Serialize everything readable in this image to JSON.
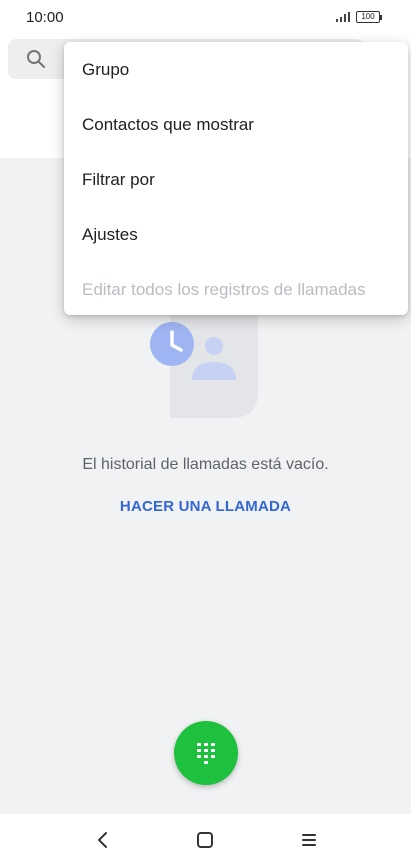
{
  "status_bar": {
    "time": "10:00",
    "battery": "100"
  },
  "search": {
    "icon": "search-icon"
  },
  "menu": {
    "items": [
      {
        "label": "Grupo",
        "enabled": true
      },
      {
        "label": "Contactos que mostrar",
        "enabled": true
      },
      {
        "label": "Filtrar por",
        "enabled": true
      },
      {
        "label": "Ajustes",
        "enabled": true
      },
      {
        "label": "Editar todos los registros de llamadas",
        "enabled": false
      }
    ]
  },
  "main": {
    "empty_message": "El historial de llamadas está vacío.",
    "make_call_label": "HACER UNA LLAMADA",
    "illustration_icon": "call-history-empty-icon"
  },
  "fab": {
    "icon": "dialpad-icon",
    "color": "#1ec13d"
  },
  "nav": {
    "back_icon": "back-icon",
    "home_icon": "home-icon",
    "menu_icon": "menu-icon"
  },
  "colors": {
    "accent": "#3367d6",
    "background": "#f1f2f4"
  }
}
